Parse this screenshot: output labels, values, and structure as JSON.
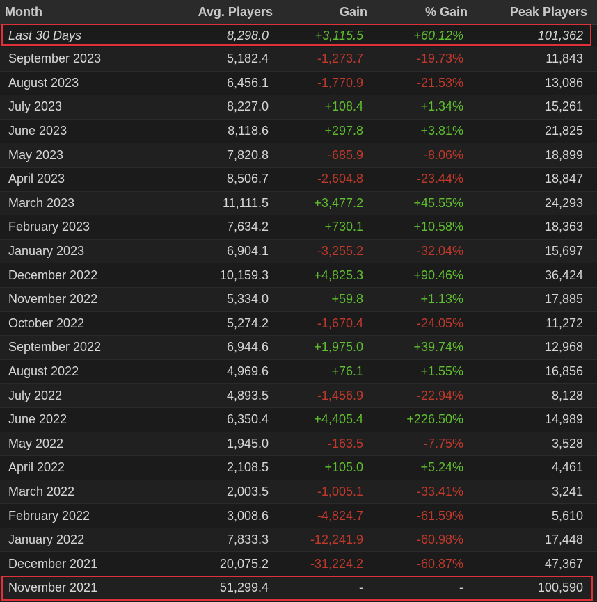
{
  "headers": {
    "month": "Month",
    "avg": "Avg. Players",
    "gain": "Gain",
    "pct": "% Gain",
    "peak": "Peak Players"
  },
  "rows": [
    {
      "month": "Last 30 Days",
      "avg": "8,298.0",
      "gain": "+3,115.5",
      "pct": "+60.12%",
      "peak": "101,362",
      "trend": "pos"
    },
    {
      "month": "September 2023",
      "avg": "5,182.4",
      "gain": "-1,273.7",
      "pct": "-19.73%",
      "peak": "11,843",
      "trend": "neg"
    },
    {
      "month": "August 2023",
      "avg": "6,456.1",
      "gain": "-1,770.9",
      "pct": "-21.53%",
      "peak": "13,086",
      "trend": "neg"
    },
    {
      "month": "July 2023",
      "avg": "8,227.0",
      "gain": "+108.4",
      "pct": "+1.34%",
      "peak": "15,261",
      "trend": "pos"
    },
    {
      "month": "June 2023",
      "avg": "8,118.6",
      "gain": "+297.8",
      "pct": "+3.81%",
      "peak": "21,825",
      "trend": "pos"
    },
    {
      "month": "May 2023",
      "avg": "7,820.8",
      "gain": "-685.9",
      "pct": "-8.06%",
      "peak": "18,899",
      "trend": "neg"
    },
    {
      "month": "April 2023",
      "avg": "8,506.7",
      "gain": "-2,604.8",
      "pct": "-23.44%",
      "peak": "18,847",
      "trend": "neg"
    },
    {
      "month": "March 2023",
      "avg": "11,111.5",
      "gain": "+3,477.2",
      "pct": "+45.55%",
      "peak": "24,293",
      "trend": "pos"
    },
    {
      "month": "February 2023",
      "avg": "7,634.2",
      "gain": "+730.1",
      "pct": "+10.58%",
      "peak": "18,363",
      "trend": "pos"
    },
    {
      "month": "January 2023",
      "avg": "6,904.1",
      "gain": "-3,255.2",
      "pct": "-32.04%",
      "peak": "15,697",
      "trend": "neg"
    },
    {
      "month": "December 2022",
      "avg": "10,159.3",
      "gain": "+4,825.3",
      "pct": "+90.46%",
      "peak": "36,424",
      "trend": "pos"
    },
    {
      "month": "November 2022",
      "avg": "5,334.0",
      "gain": "+59.8",
      "pct": "+1.13%",
      "peak": "17,885",
      "trend": "pos"
    },
    {
      "month": "October 2022",
      "avg": "5,274.2",
      "gain": "-1,670.4",
      "pct": "-24.05%",
      "peak": "11,272",
      "trend": "neg"
    },
    {
      "month": "September 2022",
      "avg": "6,944.6",
      "gain": "+1,975.0",
      "pct": "+39.74%",
      "peak": "12,968",
      "trend": "pos"
    },
    {
      "month": "August 2022",
      "avg": "4,969.6",
      "gain": "+76.1",
      "pct": "+1.55%",
      "peak": "16,856",
      "trend": "pos"
    },
    {
      "month": "July 2022",
      "avg": "4,893.5",
      "gain": "-1,456.9",
      "pct": "-22.94%",
      "peak": "8,128",
      "trend": "neg"
    },
    {
      "month": "June 2022",
      "avg": "6,350.4",
      "gain": "+4,405.4",
      "pct": "+226.50%",
      "peak": "14,989",
      "trend": "pos"
    },
    {
      "month": "May 2022",
      "avg": "1,945.0",
      "gain": "-163.5",
      "pct": "-7.75%",
      "peak": "3,528",
      "trend": "neg"
    },
    {
      "month": "April 2022",
      "avg": "2,108.5",
      "gain": "+105.0",
      "pct": "+5.24%",
      "peak": "4,461",
      "trend": "pos"
    },
    {
      "month": "March 2022",
      "avg": "2,003.5",
      "gain": "-1,005.1",
      "pct": "-33.41%",
      "peak": "3,241",
      "trend": "neg"
    },
    {
      "month": "February 2022",
      "avg": "3,008.6",
      "gain": "-4,824.7",
      "pct": "-61.59%",
      "peak": "5,610",
      "trend": "neg"
    },
    {
      "month": "January 2022",
      "avg": "7,833.3",
      "gain": "-12,241.9",
      "pct": "-60.98%",
      "peak": "17,448",
      "trend": "neg"
    },
    {
      "month": "December 2021",
      "avg": "20,075.2",
      "gain": "-31,224.2",
      "pct": "-60.87%",
      "peak": "47,367",
      "trend": "neg"
    },
    {
      "month": "November 2021",
      "avg": "51,299.4",
      "gain": "-",
      "pct": "-",
      "peak": "100,590",
      "trend": "neu"
    }
  ],
  "colors": {
    "positive": "#5fbf2f",
    "negative": "#c0392b",
    "highlight": "#e0303a"
  }
}
